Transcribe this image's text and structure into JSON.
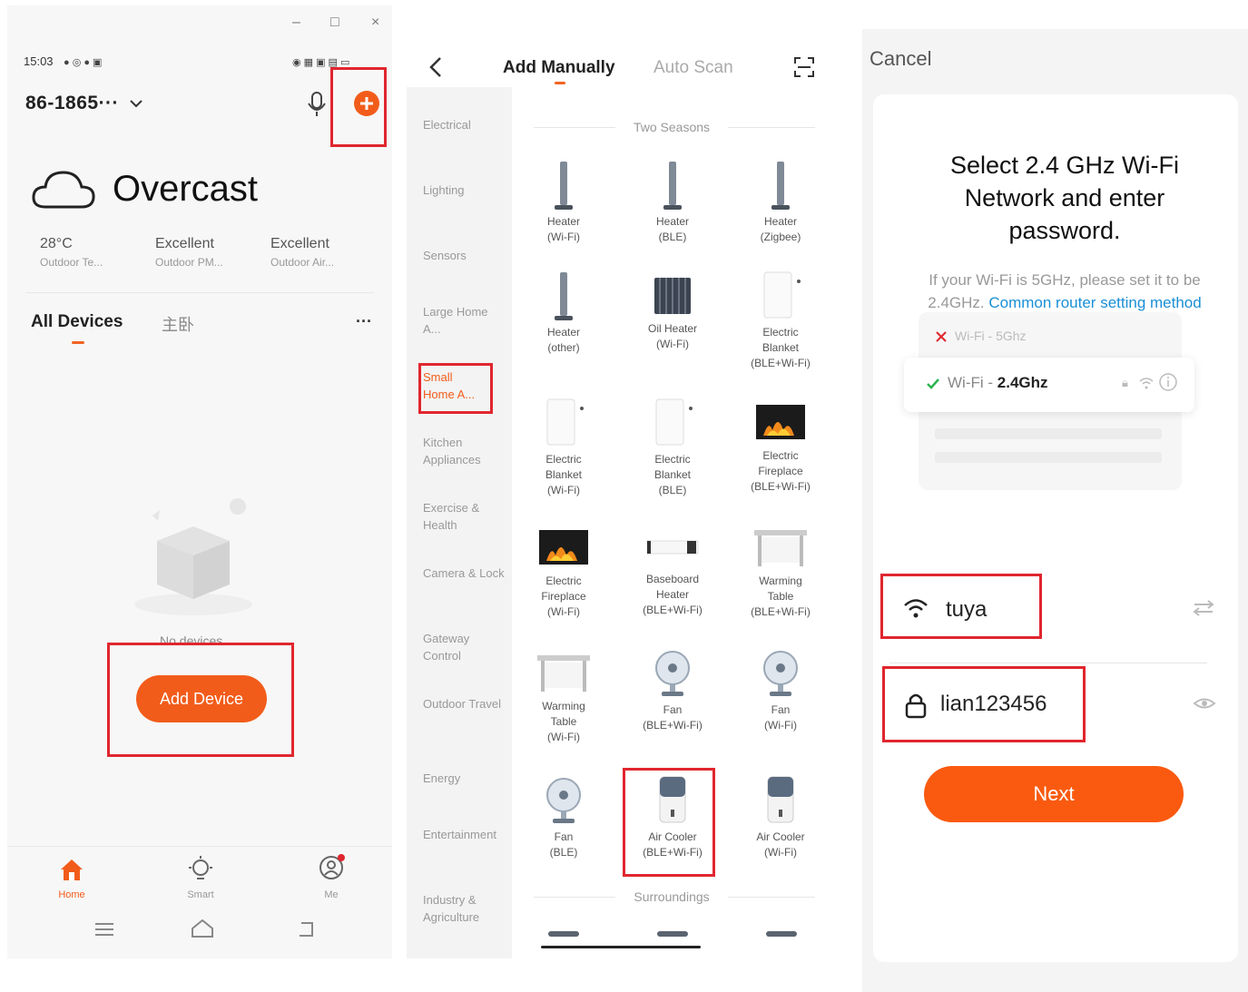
{
  "colors": {
    "accent": "#f25c1a",
    "highlight_box": "#e0262e",
    "link": "#1a8fd6",
    "check": "#2db352",
    "cross": "#e0262e"
  },
  "home": {
    "window_controls": [
      "–",
      "□",
      "×"
    ],
    "status_time": "15:03",
    "home_name": "86-1865···",
    "weather": "Overcast",
    "stats": [
      {
        "value": "28°C",
        "label": "Outdoor Te..."
      },
      {
        "value": "Excellent",
        "label": "Outdoor PM..."
      },
      {
        "value": "Excellent",
        "label": "Outdoor Air..."
      }
    ],
    "tabs": [
      "All Devices",
      "主卧"
    ],
    "more": "···",
    "empty_text": "No devices",
    "add_device": "Add Device",
    "nav": [
      "Home",
      "Smart",
      "Me"
    ]
  },
  "add": {
    "tabs": [
      "Add Manually",
      "Auto Scan"
    ],
    "categories": [
      "Electrical",
      "Lighting",
      "Sensors",
      "Large Home A...",
      "Small Home A...",
      "Kitchen Appliances",
      "Exercise & Health",
      "Camera & Lock",
      "Gateway Control",
      "Outdoor Travel",
      "Energy",
      "Entertainment",
      "Industry & Agriculture"
    ],
    "section1": "Two Seasons",
    "section2": "Surroundings",
    "devices": [
      "Heater\n(Wi-Fi)",
      "Heater\n(BLE)",
      "Heater\n(Zigbee)",
      "Heater\n(other)",
      "Oil Heater\n(Wi-Fi)",
      "Electric\nBlanket\n(BLE+Wi-Fi)",
      "Electric\nBlanket\n(Wi-Fi)",
      "Electric\nBlanket\n(BLE)",
      "Electric\nFireplace\n(BLE+Wi-Fi)",
      "Electric\nFireplace\n(Wi-Fi)",
      "Baseboard\nHeater\n(BLE+Wi-Fi)",
      "Warming\nTable\n(BLE+Wi-Fi)",
      "Warming\nTable\n(Wi-Fi)",
      "Fan\n(BLE+Wi-Fi)",
      "Fan\n(Wi-Fi)",
      "Fan\n(BLE)",
      "Air Cooler\n(BLE+Wi-Fi)",
      "Air Cooler\n(Wi-Fi)"
    ]
  },
  "wifi": {
    "cancel": "Cancel",
    "title": "Select 2.4 GHz Wi-Fi Network and enter password.",
    "hint": "If your Wi-Fi is 5GHz, please set it to be 2.4GHz.",
    "hint_link": "Common router setting method",
    "net_5g": "Wi-Fi - 5Ghz",
    "net_24_prefix": "Wi-Fi - ",
    "net_24_band": "2.4Ghz",
    "ssid": "tuya",
    "password": "lian123456",
    "next": "Next"
  }
}
